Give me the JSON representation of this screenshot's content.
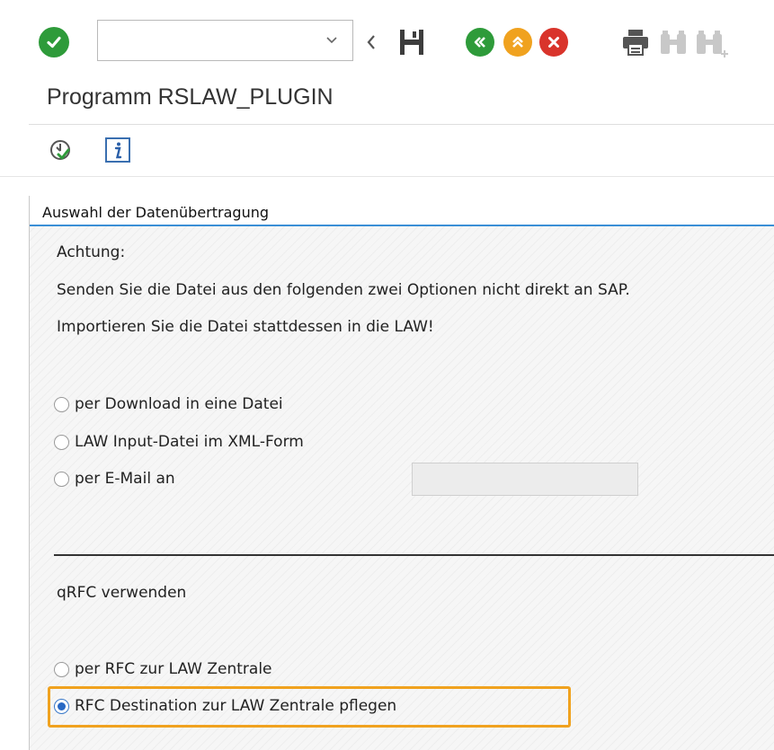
{
  "toolbar": {
    "icons": [
      "check-circle-icon",
      "chevron-down-icon",
      "back-icon",
      "save-icon",
      "back-green-icon",
      "exit-up-icon",
      "cancel-icon",
      "print-icon",
      "find-icon",
      "find-next-icon"
    ],
    "command_field_value": ""
  },
  "title": "Programm RSLAW_PLUGIN",
  "app_toolbar": {
    "icons": [
      "execute-icon",
      "info-icon"
    ]
  },
  "group": {
    "title": "Auswahl der Datenübertragung",
    "warning_heading": "Achtung:",
    "warning_line1": "Senden Sie die Datei aus den folgenden zwei Optionen nicht direkt an SAP.",
    "warning_line2": "Importieren Sie die Datei stattdessen in die LAW!",
    "options": [
      {
        "label": "per Download in eine Datei",
        "selected": false
      },
      {
        "label": "LAW Input-Datei im XML-Form",
        "selected": false
      },
      {
        "label": "per E-Mail an",
        "selected": false
      }
    ],
    "email_value": "",
    "qrfc_label": "qRFC verwenden",
    "rfc_options": [
      {
        "label": "per RFC zur LAW Zentrale",
        "selected": false
      },
      {
        "label": "RFC Destination zur LAW Zentrale pflegen",
        "selected": true
      }
    ]
  },
  "colors": {
    "ok_green": "#2e9b3a",
    "back_green": "#2e9b3a",
    "exit_orange": "#f0a21f",
    "cancel_red": "#d9342b",
    "accent_blue": "#3a8fd6",
    "highlight_orange": "#f0a21f"
  }
}
